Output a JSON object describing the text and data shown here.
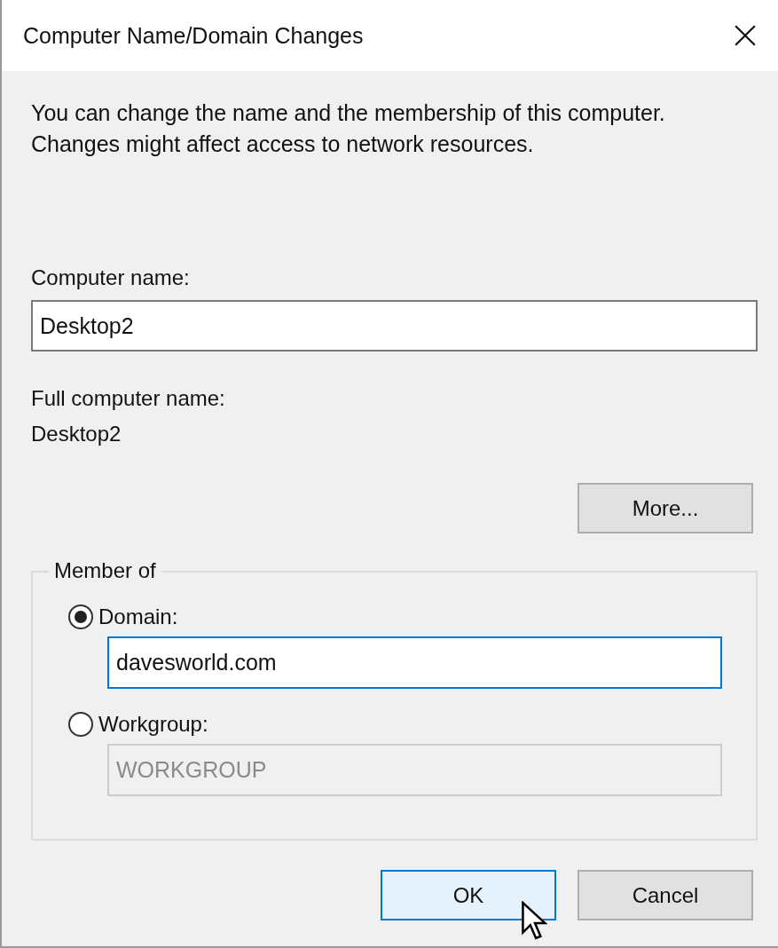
{
  "window": {
    "title": "Computer Name/Domain Changes"
  },
  "description": "You can change the name and the membership of this computer. Changes might affect access to network resources.",
  "computer_name": {
    "label": "Computer name:",
    "value": "Desktop2"
  },
  "full_computer_name": {
    "label": "Full computer name:",
    "value": "Desktop2"
  },
  "more_button": "More...",
  "member_of": {
    "legend": "Member of",
    "options": [
      {
        "label": "Domain:",
        "selected": true,
        "field": {
          "value": "davesworld.com",
          "disabled": false,
          "focused": true
        }
      },
      {
        "label": "Workgroup:",
        "selected": false,
        "field": {
          "value": "WORKGROUP",
          "disabled": true,
          "focused": false
        }
      }
    ]
  },
  "buttons": [
    {
      "label": "OK",
      "default": true
    },
    {
      "label": "Cancel",
      "default": false
    }
  ]
}
